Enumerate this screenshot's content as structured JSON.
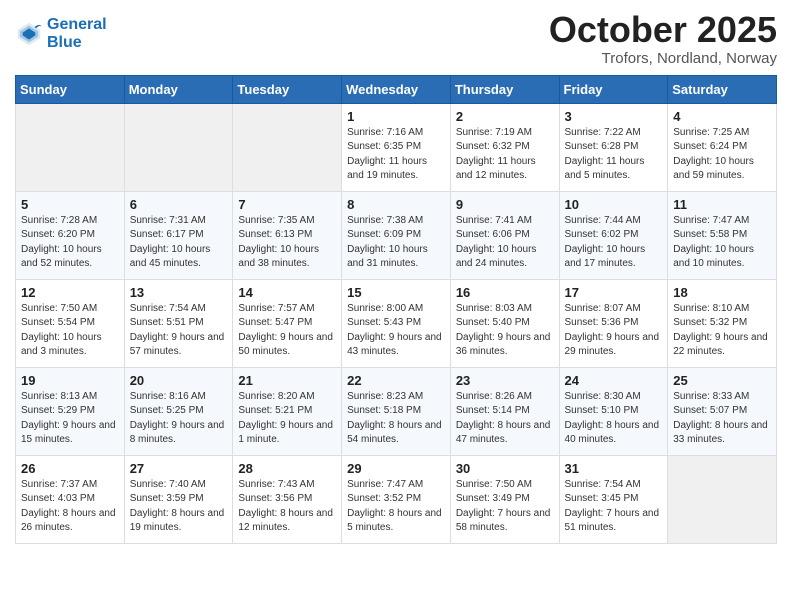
{
  "header": {
    "logo_line1": "General",
    "logo_line2": "Blue",
    "month_title": "October 2025",
    "location": "Trofors, Nordland, Norway"
  },
  "days_of_week": [
    "Sunday",
    "Monday",
    "Tuesday",
    "Wednesday",
    "Thursday",
    "Friday",
    "Saturday"
  ],
  "weeks": [
    [
      {
        "day": "",
        "info": ""
      },
      {
        "day": "",
        "info": ""
      },
      {
        "day": "",
        "info": ""
      },
      {
        "day": "1",
        "info": "Sunrise: 7:16 AM\nSunset: 6:35 PM\nDaylight: 11 hours\nand 19 minutes."
      },
      {
        "day": "2",
        "info": "Sunrise: 7:19 AM\nSunset: 6:32 PM\nDaylight: 11 hours\nand 12 minutes."
      },
      {
        "day": "3",
        "info": "Sunrise: 7:22 AM\nSunset: 6:28 PM\nDaylight: 11 hours\nand 5 minutes."
      },
      {
        "day": "4",
        "info": "Sunrise: 7:25 AM\nSunset: 6:24 PM\nDaylight: 10 hours\nand 59 minutes."
      }
    ],
    [
      {
        "day": "5",
        "info": "Sunrise: 7:28 AM\nSunset: 6:20 PM\nDaylight: 10 hours\nand 52 minutes."
      },
      {
        "day": "6",
        "info": "Sunrise: 7:31 AM\nSunset: 6:17 PM\nDaylight: 10 hours\nand 45 minutes."
      },
      {
        "day": "7",
        "info": "Sunrise: 7:35 AM\nSunset: 6:13 PM\nDaylight: 10 hours\nand 38 minutes."
      },
      {
        "day": "8",
        "info": "Sunrise: 7:38 AM\nSunset: 6:09 PM\nDaylight: 10 hours\nand 31 minutes."
      },
      {
        "day": "9",
        "info": "Sunrise: 7:41 AM\nSunset: 6:06 PM\nDaylight: 10 hours\nand 24 minutes."
      },
      {
        "day": "10",
        "info": "Sunrise: 7:44 AM\nSunset: 6:02 PM\nDaylight: 10 hours\nand 17 minutes."
      },
      {
        "day": "11",
        "info": "Sunrise: 7:47 AM\nSunset: 5:58 PM\nDaylight: 10 hours\nand 10 minutes."
      }
    ],
    [
      {
        "day": "12",
        "info": "Sunrise: 7:50 AM\nSunset: 5:54 PM\nDaylight: 10 hours\nand 3 minutes."
      },
      {
        "day": "13",
        "info": "Sunrise: 7:54 AM\nSunset: 5:51 PM\nDaylight: 9 hours\nand 57 minutes."
      },
      {
        "day": "14",
        "info": "Sunrise: 7:57 AM\nSunset: 5:47 PM\nDaylight: 9 hours\nand 50 minutes."
      },
      {
        "day": "15",
        "info": "Sunrise: 8:00 AM\nSunset: 5:43 PM\nDaylight: 9 hours\nand 43 minutes."
      },
      {
        "day": "16",
        "info": "Sunrise: 8:03 AM\nSunset: 5:40 PM\nDaylight: 9 hours\nand 36 minutes."
      },
      {
        "day": "17",
        "info": "Sunrise: 8:07 AM\nSunset: 5:36 PM\nDaylight: 9 hours\nand 29 minutes."
      },
      {
        "day": "18",
        "info": "Sunrise: 8:10 AM\nSunset: 5:32 PM\nDaylight: 9 hours\nand 22 minutes."
      }
    ],
    [
      {
        "day": "19",
        "info": "Sunrise: 8:13 AM\nSunset: 5:29 PM\nDaylight: 9 hours\nand 15 minutes."
      },
      {
        "day": "20",
        "info": "Sunrise: 8:16 AM\nSunset: 5:25 PM\nDaylight: 9 hours\nand 8 minutes."
      },
      {
        "day": "21",
        "info": "Sunrise: 8:20 AM\nSunset: 5:21 PM\nDaylight: 9 hours\nand 1 minute."
      },
      {
        "day": "22",
        "info": "Sunrise: 8:23 AM\nSunset: 5:18 PM\nDaylight: 8 hours\nand 54 minutes."
      },
      {
        "day": "23",
        "info": "Sunrise: 8:26 AM\nSunset: 5:14 PM\nDaylight: 8 hours\nand 47 minutes."
      },
      {
        "day": "24",
        "info": "Sunrise: 8:30 AM\nSunset: 5:10 PM\nDaylight: 8 hours\nand 40 minutes."
      },
      {
        "day": "25",
        "info": "Sunrise: 8:33 AM\nSunset: 5:07 PM\nDaylight: 8 hours\nand 33 minutes."
      }
    ],
    [
      {
        "day": "26",
        "info": "Sunrise: 7:37 AM\nSunset: 4:03 PM\nDaylight: 8 hours\nand 26 minutes."
      },
      {
        "day": "27",
        "info": "Sunrise: 7:40 AM\nSunset: 3:59 PM\nDaylight: 8 hours\nand 19 minutes."
      },
      {
        "day": "28",
        "info": "Sunrise: 7:43 AM\nSunset: 3:56 PM\nDaylight: 8 hours\nand 12 minutes."
      },
      {
        "day": "29",
        "info": "Sunrise: 7:47 AM\nSunset: 3:52 PM\nDaylight: 8 hours\nand 5 minutes."
      },
      {
        "day": "30",
        "info": "Sunrise: 7:50 AM\nSunset: 3:49 PM\nDaylight: 7 hours\nand 58 minutes."
      },
      {
        "day": "31",
        "info": "Sunrise: 7:54 AM\nSunset: 3:45 PM\nDaylight: 7 hours\nand 51 minutes."
      },
      {
        "day": "",
        "info": ""
      }
    ]
  ]
}
